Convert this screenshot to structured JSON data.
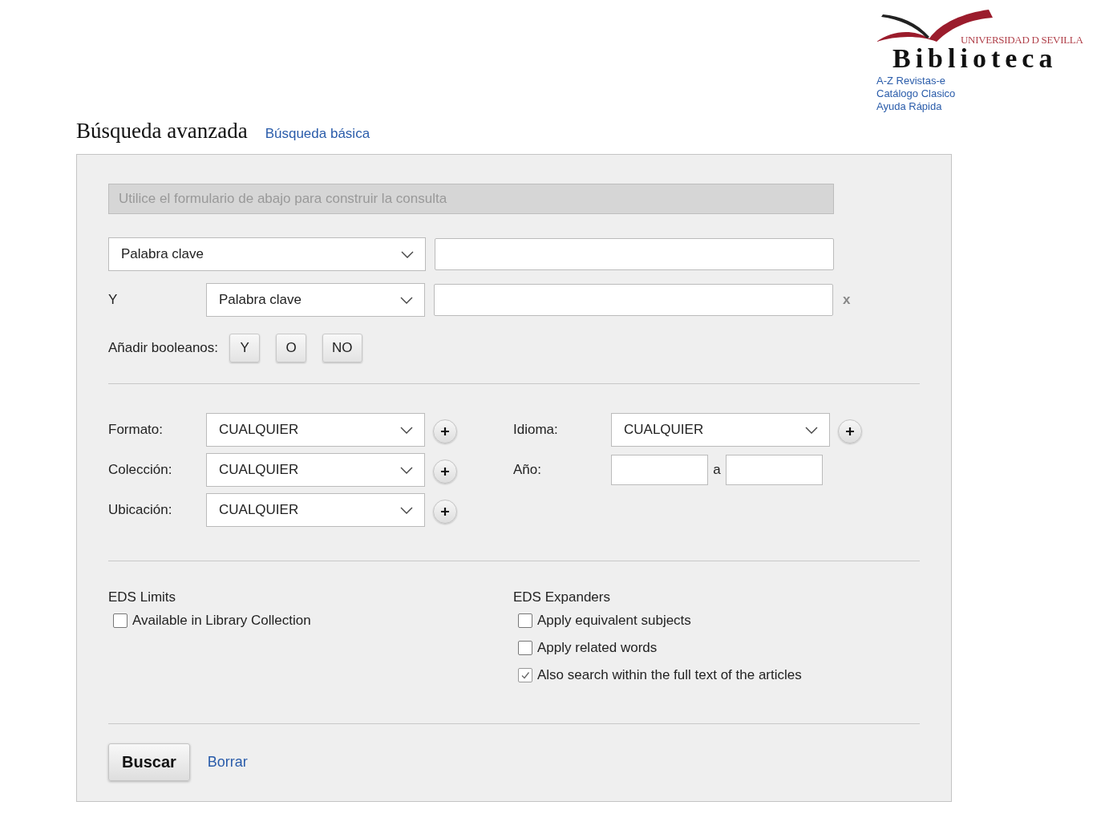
{
  "logo": {
    "university": "UNIVERSIDAD D SEVILLA",
    "name": "Biblioteca"
  },
  "header_links": [
    "A-Z Revistas-e",
    "Catálogo Clasico",
    "Ayuda Rápida"
  ],
  "page_title": "Búsqueda avanzada",
  "basic_search_link": "Búsqueda básica",
  "query_hint": "Utilice el formulario de abajo para construir la consulta",
  "query_rows": [
    {
      "field": "Palabra clave"
    },
    {
      "operator": "Y",
      "field": "Palabra clave",
      "remove": "x"
    }
  ],
  "boolean_label": "Añadir booleanos:",
  "boolean_buttons": [
    "Y",
    "O",
    "NO"
  ],
  "filters_left": [
    {
      "kind": "select",
      "label": "Formato:",
      "value": "CUALQUIER"
    },
    {
      "kind": "select",
      "label": "Colección:",
      "value": "CUALQUIER"
    },
    {
      "kind": "select",
      "label": "Ubicación:",
      "value": "CUALQUIER"
    }
  ],
  "filters_right": [
    {
      "kind": "select",
      "label": "Idioma:",
      "value": "CUALQUIER"
    },
    {
      "kind": "range",
      "label": "Año:",
      "separator": "a"
    }
  ],
  "limits": {
    "title": "EDS Limits",
    "options": [
      {
        "label": "Available in Library Collection",
        "checked": false
      }
    ]
  },
  "expanders": {
    "title": "EDS Expanders",
    "options": [
      {
        "label": "Apply equivalent subjects",
        "checked": false
      },
      {
        "label": "Apply related words",
        "checked": false
      },
      {
        "label": "Also search within the full text of the articles",
        "checked": true
      }
    ]
  },
  "buttons": {
    "search": "Buscar",
    "clear": "Borrar"
  }
}
